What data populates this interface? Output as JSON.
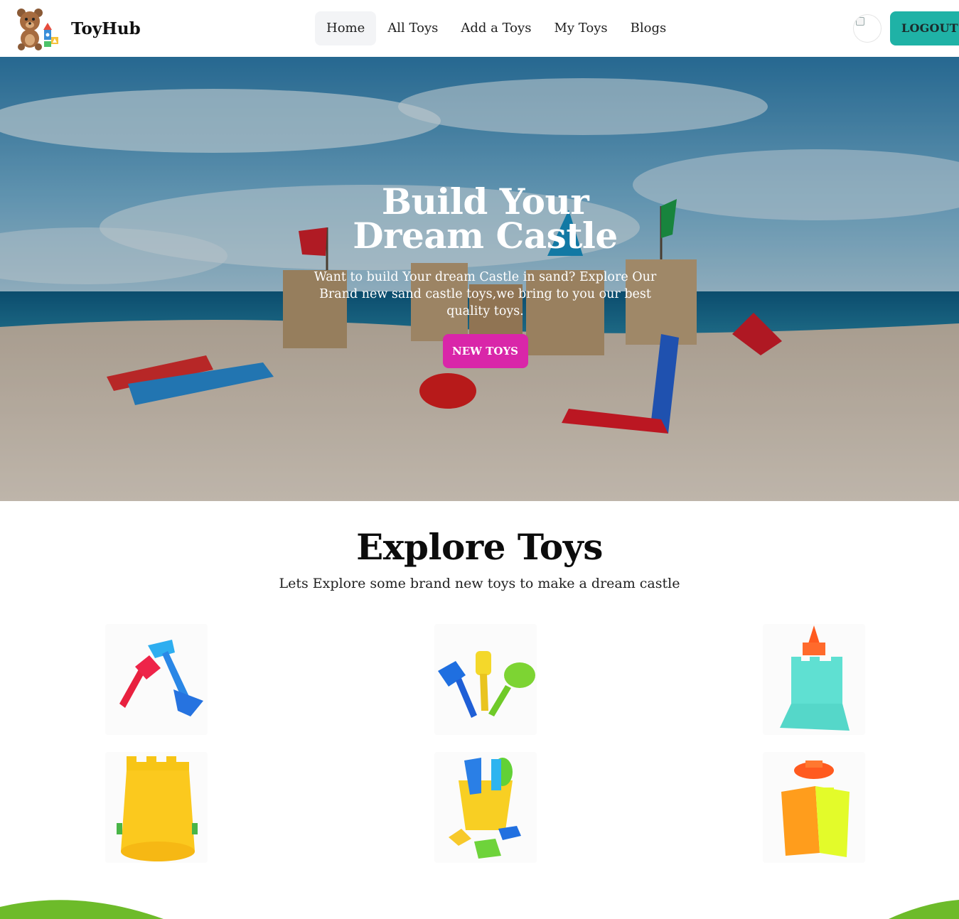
{
  "header": {
    "brand_name": "ToyHub",
    "nav": [
      {
        "label": "Home",
        "active": true
      },
      {
        "label": "All Toys",
        "active": false
      },
      {
        "label": "Add a Toys",
        "active": false
      },
      {
        "label": "My Toys",
        "active": false
      },
      {
        "label": "Blogs",
        "active": false
      }
    ],
    "logout_label": "LOGOUT"
  },
  "hero": {
    "title": "Build Your Dream Castle",
    "text": "Want to build Your dream Castle in sand? Explore Our Brand new sand castle toys,we bring to you our best quality toys.",
    "button_label": "NEW TOYS"
  },
  "explore": {
    "title": "Explore Toys",
    "subtitle": "Lets Explore some brand new toys to make a dream castle"
  },
  "toys": [
    {
      "icon": "shovel-rake-set-icon"
    },
    {
      "icon": "three-spades-set-icon"
    },
    {
      "icon": "castle-mold-teal-icon"
    },
    {
      "icon": "yellow-castle-bucket-icon"
    },
    {
      "icon": "bucket-mold-set-icon"
    },
    {
      "icon": "tower-mold-orange-icon"
    }
  ],
  "colors": {
    "accent_teal": "#1fb2a6",
    "accent_pink": "#d926a9",
    "hill_green": "#6dbb2a"
  }
}
